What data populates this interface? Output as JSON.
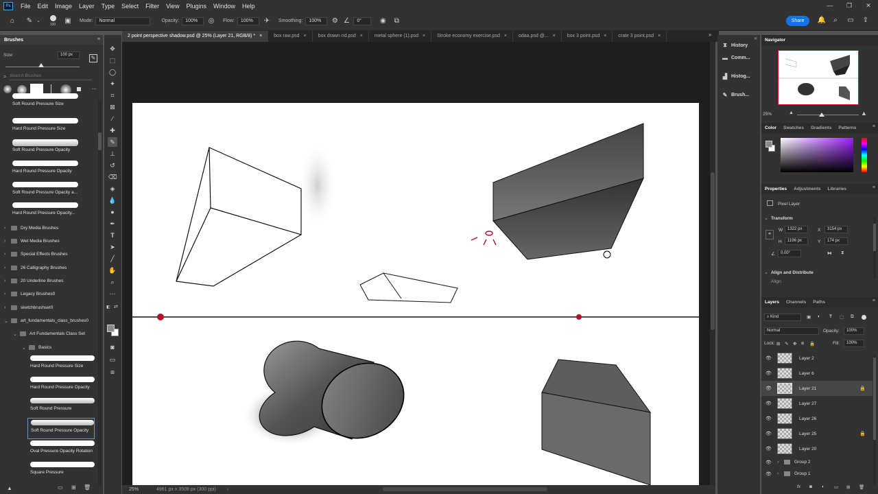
{
  "menu": [
    "File",
    "Edit",
    "Image",
    "Layer",
    "Type",
    "Select",
    "Filter",
    "View",
    "Plugins",
    "Window",
    "Help"
  ],
  "options": {
    "brush_size": "100",
    "mode_label": "Mode:",
    "mode_value": "Normal",
    "opacity_label": "Opacity:",
    "opacity_value": "100%",
    "flow_label": "Flow:",
    "flow_value": "100%",
    "smoothing_label": "Smoothing:",
    "smoothing_value": "100%",
    "angle_value": "0°",
    "share_label": "Share"
  },
  "brushes_panel": {
    "title": "Brushes",
    "size_label": "Size:",
    "size_value": "100 px",
    "search_placeholder": "Search Brushes",
    "top_items": [
      "Soft Round Pressure Size",
      "Hard Round Pressure Size",
      "Soft Round Pressure Opacity",
      "Hard Round Pressure Opacity",
      "Soft Round Pressure Opacity a...",
      "Hard Round Pressure Opacity..."
    ],
    "folders": [
      "Dry Media Brushes",
      "Wet Media Brushes",
      "Special Effects Brushes",
      "26 Calligraphy Brushes",
      "20 Underline Brushes",
      "Legacy Brushes0",
      "sketchbrushset0",
      "art_fundamentals_class_brushes0",
      "Art Fundamentals Class Set",
      "Basics"
    ],
    "basics_items": [
      "Hard Round Pressure Size",
      "Hard Round Pressure Opacity",
      "Soft Round Pressure",
      "Soft Round Pressure Opacity",
      "Oval Pressure Opacity Rotation",
      "Square Pressure"
    ]
  },
  "doc_tabs": [
    "2 point perspective shadow.psd @ 25% (Layer 21, RGB/8) *",
    "box raw.psd",
    "box drawn nd.psd",
    "metal sphere (1).psd",
    "Stroke economy exercise.psd",
    "odaa.psd @...",
    "box 3 point.psd",
    "crate 3 point.psd"
  ],
  "status": {
    "zoom": "25%",
    "doc_info": "4961 px x 3508 px (300 ppi)"
  },
  "side_panels": [
    "History",
    "Comm...",
    "Histog...",
    "Brush..."
  ],
  "navigator": {
    "title": "Navigator",
    "zoom": "25%"
  },
  "color_tabs": [
    "Color",
    "Swatches",
    "Gradients",
    "Patterns"
  ],
  "properties": {
    "tabs": [
      "Properties",
      "Adjustments",
      "Libraries"
    ],
    "layer_type": "Pixel Layer",
    "transform_label": "Transform",
    "w_label": "W",
    "w_value": "1322 px",
    "x_label": "X",
    "x_value": "3154 px",
    "h_label": "H",
    "h_value": "1196 px",
    "y_label": "Y",
    "y_value": "174 px",
    "angle_value": "0.00°",
    "align_label": "Align and Distribute",
    "align_sub": "Align:"
  },
  "layers_panel": {
    "tabs": [
      "Layers",
      "Channels",
      "Paths"
    ],
    "kind": "Kind",
    "blend_mode": "Normal",
    "opacity_label": "Opacity:",
    "opacity_value": "100%",
    "lock_label": "Lock:",
    "fill_label": "Fill:",
    "fill_value": "100%",
    "layers": [
      {
        "name": "Layer 2",
        "selected": false,
        "locked": false
      },
      {
        "name": "Layer 6",
        "selected": false,
        "locked": false
      },
      {
        "name": "Layer 21",
        "selected": true,
        "locked": true
      },
      {
        "name": "Layer 27",
        "selected": false,
        "locked": false
      },
      {
        "name": "Layer 26",
        "selected": false,
        "locked": false
      },
      {
        "name": "Layer 25",
        "selected": false,
        "locked": true
      },
      {
        "name": "Layer 20",
        "selected": false,
        "locked": false
      }
    ],
    "groups": [
      "Group 2",
      "Group 1"
    ]
  },
  "colors": {
    "accent": "#1473e6",
    "horizon_dot": "#b0122c"
  }
}
